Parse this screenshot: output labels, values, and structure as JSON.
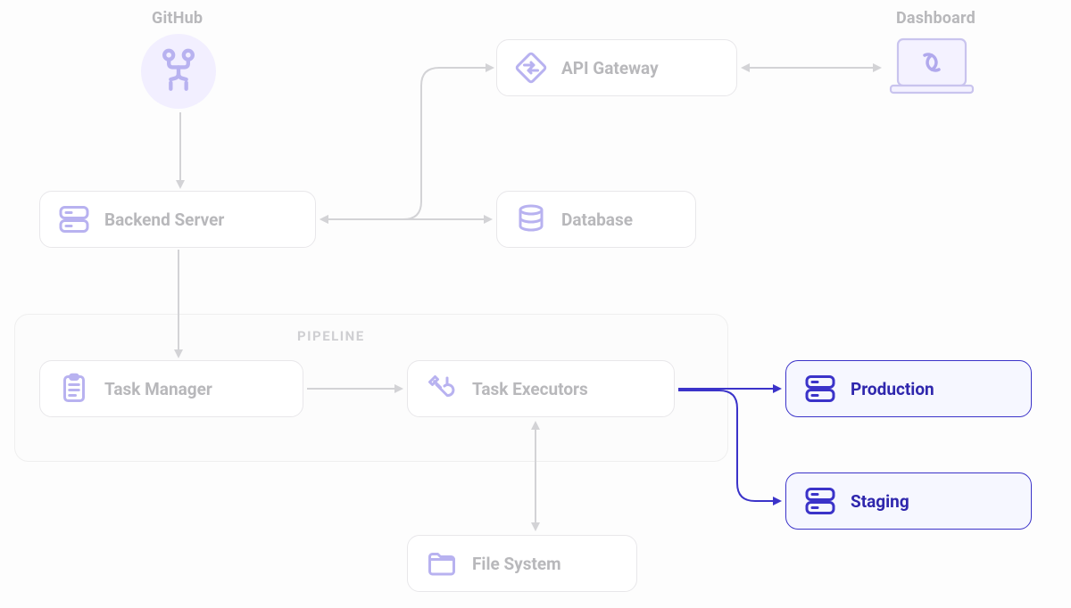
{
  "labels": {
    "github": "GitHub",
    "dashboard": "Dashboard",
    "pipeline": "PIPELINE"
  },
  "nodes": {
    "backend_server": "Backend Server",
    "api_gateway": "API Gateway",
    "database": "Database",
    "task_manager": "Task Manager",
    "task_executors": "Task Executors",
    "file_system": "File System",
    "production": "Production",
    "staging": "Staging"
  },
  "colors": {
    "muted_text": "#b8b8bb",
    "icon": "#b8b2f0",
    "border": "#e8e7ea",
    "highlight": "#3b33c9",
    "highlight_bg": "#f6f7ff"
  },
  "icons": {
    "github": "github-icon",
    "backend": "server-icon",
    "api_gateway": "swap-icon",
    "database": "database-icon",
    "dashboard": "laptop-icon",
    "task_manager": "clipboard-icon",
    "task_executors": "tools-icon",
    "file_system": "folder-icon",
    "production": "server-icon",
    "staging": "server-icon"
  }
}
